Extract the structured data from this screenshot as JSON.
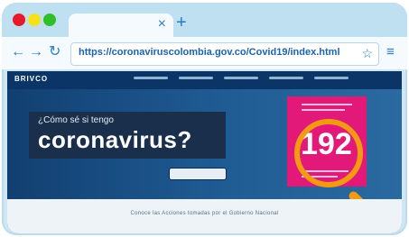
{
  "browser": {
    "tab_close_label": "×",
    "new_tab_label": "+",
    "nav": {
      "back_label": "←",
      "forward_label": "→",
      "reload_label": "↻"
    },
    "url": "https://coronaviruscolombia.gov.co/Covid19/index.html",
    "bookmark_label": "☆",
    "menu_label": "≡"
  },
  "site": {
    "logo_text": "BRIVCO",
    "hero": {
      "question": "¿Cómo sé si tengo",
      "title": "coronavirus?",
      "number": "192"
    },
    "footer_text": "Conoce las Acciones tomadas por el Gobierno Nacional"
  },
  "colors": {
    "accent": "#2a7cc7",
    "url": "#1a64b4",
    "site_background": "#0b3c70",
    "pink": "#e3197a",
    "magnifier": "#f39a12"
  }
}
